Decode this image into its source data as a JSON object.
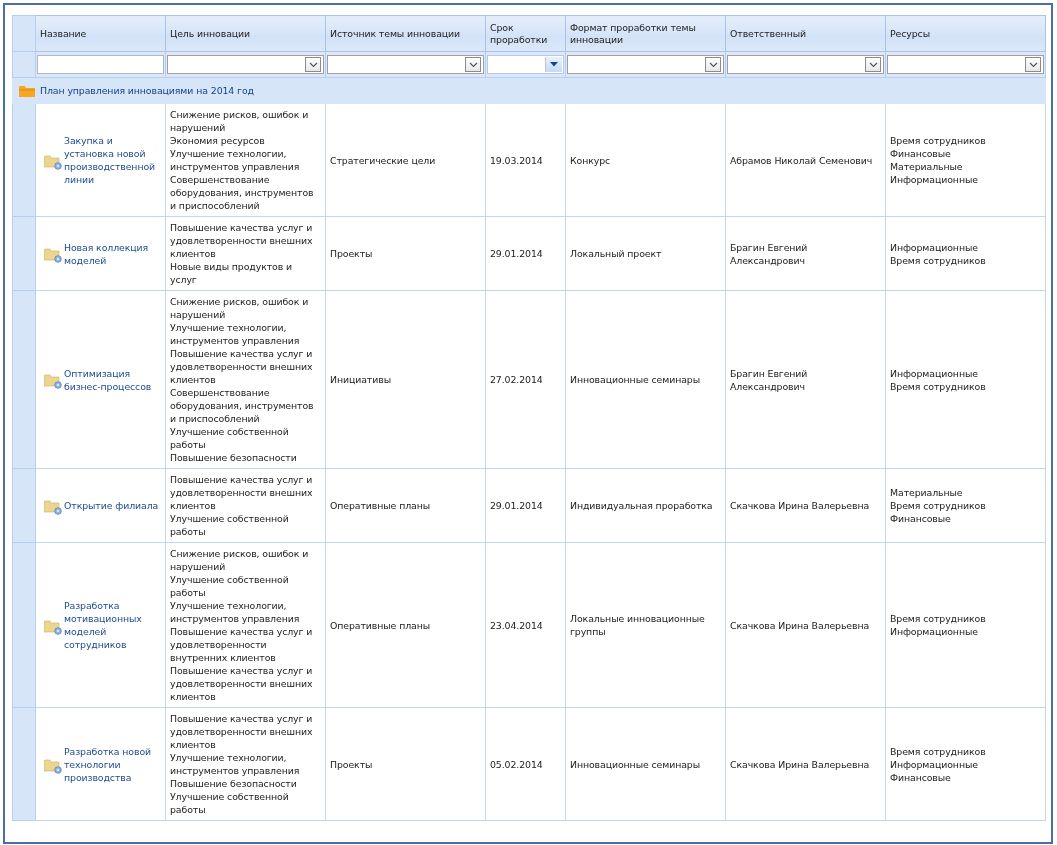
{
  "columns": [
    {
      "label": "Название"
    },
    {
      "label": "Цель инновации"
    },
    {
      "label": "Источник темы инновации"
    },
    {
      "label": "Срок проработки"
    },
    {
      "label": "Формат проработки темы инновации"
    },
    {
      "label": "Ответственный"
    },
    {
      "label": "Ресурсы"
    }
  ],
  "filters": [
    {
      "kind": "text"
    },
    {
      "kind": "combo"
    },
    {
      "kind": "combo"
    },
    {
      "kind": "date"
    },
    {
      "kind": "combo"
    },
    {
      "kind": "combo"
    },
    {
      "kind": "combo"
    }
  ],
  "group": {
    "label": "План управления инновациями на 2014 год"
  },
  "rows": [
    {
      "name": "Закупка и установка новой производственной линии",
      "goals": [
        "Снижение рисков, ошибок и нарушений",
        "Экономия ресурсов",
        "Улучшение технологии, инструментов управления",
        "Совершенствование оборудования, инструментов и приспособлений"
      ],
      "source": "Стратегические цели",
      "deadline": "19.03.2014",
      "format": "Конкурс",
      "responsible": "Абрамов Николай Семенович",
      "resources": [
        "Время сотрудников",
        "Финансовые",
        "Материальные",
        "Информационные"
      ]
    },
    {
      "name": "Новая коллекция моделей",
      "goals": [
        "Повышение качества услуг и удовлетворенности внешних клиентов",
        "Новые виды продуктов и услуг"
      ],
      "source": "Проекты",
      "deadline": "29.01.2014",
      "format": "Локальный проект",
      "responsible": "Брагин Евгений Александрович",
      "resources": [
        "Информационные",
        "Время сотрудников"
      ]
    },
    {
      "name": "Оптимизация бизнес-процессов",
      "goals": [
        "Снижение рисков, ошибок и нарушений",
        "Улучшение технологии, инструментов управления",
        "Повышение качества услуг и удовлетворенности внешних клиентов",
        "Совершенствование оборудования, инструментов и приспособлений",
        "Улучшение собственной работы",
        "Повышение безопасности"
      ],
      "source": "Инициативы",
      "deadline": "27.02.2014",
      "format": "Инновационные семинары",
      "responsible": "Брагин Евгений Александрович",
      "resources": [
        "Информационные",
        "Время сотрудников"
      ]
    },
    {
      "name": "Открытие филиала",
      "goals": [
        "Повышение качества услуг и удовлетворенности внешних клиентов",
        "Улучшение собственной работы"
      ],
      "source": "Оперативные планы",
      "deadline": "29.01.2014",
      "format": "Индивидуальная проработка",
      "responsible": "Скачкова Ирина Валерьевна",
      "resources": [
        "Материальные",
        "Время сотрудников",
        "Финансовые"
      ]
    },
    {
      "name": "Разработка мотивационных моделей сотрудников",
      "goals": [
        "Снижение рисков, ошибок и нарушений",
        "Улучшение собственной работы",
        "Улучшение технологии, инструментов управления",
        "Повышение качества услуг и удовлетворенности внутренних клиентов",
        "Повышение качества услуг и удовлетворенности внешних клиентов"
      ],
      "source": "Оперативные планы",
      "deadline": "23.04.2014",
      "format": "Локальные инновационные группы",
      "responsible": "Скачкова Ирина Валерьевна",
      "resources": [
        "Время сотрудников",
        "Информационные"
      ]
    },
    {
      "name": "Разработка новой технологии производства",
      "goals": [
        "Повышение качества услуг и удовлетворенности внешних клиентов",
        "Улучшение технологии, инструментов управления",
        "Повышение безопасности",
        "Улучшение собственной работы"
      ],
      "source": "Проекты",
      "deadline": "05.02.2014",
      "format": "Инновационные семинары",
      "responsible": "Скачкова Ирина Валерьевна",
      "resources": [
        "Время сотрудников",
        "Информационные",
        "Финансовые"
      ]
    }
  ]
}
